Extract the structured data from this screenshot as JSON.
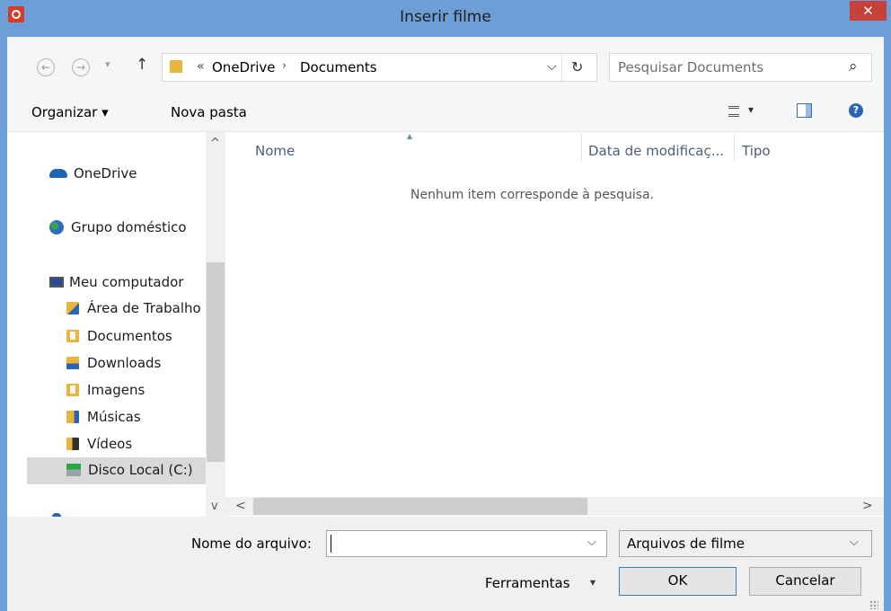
{
  "window": {
    "title": "Inserir filme",
    "close_glyph": "✕"
  },
  "nav": {
    "back": "←",
    "forward": "→",
    "history": "▾",
    "up": "↑"
  },
  "address": {
    "prefix": "«",
    "crumbs": [
      "OneDrive",
      "Documents"
    ],
    "separator": "›",
    "dropdown": "⌵",
    "refresh": "↻"
  },
  "search": {
    "placeholder": "Pesquisar Documents",
    "icon": "⌕"
  },
  "toolbar": {
    "organize_label": "Organizar ▾",
    "new_folder_label": "Nova pasta",
    "view_arrow": "▾",
    "help": "?"
  },
  "sidebar": {
    "scroll_up": "^",
    "scroll_down": "v",
    "items": [
      {
        "label": "OneDrive",
        "icon": "onedrive-icon",
        "color": "#1e64b4"
      },
      {
        "label": "Grupo doméstico",
        "icon": "homegroup-icon"
      },
      {
        "label": "Meu computador",
        "icon": "computer-icon"
      },
      {
        "label": "Área de Trabalho",
        "icon": "desktop-folder-icon"
      },
      {
        "label": "Documentos",
        "icon": "documents-folder-icon"
      },
      {
        "label": "Downloads",
        "icon": "downloads-folder-icon"
      },
      {
        "label": "Imagens",
        "icon": "pictures-folder-icon"
      },
      {
        "label": "Músicas",
        "icon": "music-folder-icon"
      },
      {
        "label": "Vídeos",
        "icon": "videos-folder-icon"
      },
      {
        "label": "Disco Local (C:)",
        "icon": "drive-icon"
      }
    ]
  },
  "filelist": {
    "columns": [
      "Nome",
      "Data de modificaç...",
      "Tipo"
    ],
    "sort_indicator": "▲",
    "empty_message": "Nenhum item corresponde à pesquisa.",
    "scroll_left": "<",
    "scroll_right": ">"
  },
  "footer": {
    "filename_label": "Nome do arquivo:",
    "filename_value": "",
    "filename_dropdown": "⌵",
    "filetype_value": "Arquivos de filme",
    "filetype_dropdown": "⌵",
    "tools_label": "Ferramentas",
    "tools_arrow": "▾",
    "ok_label": "OK",
    "cancel_label": "Cancelar"
  },
  "colors": {
    "accent": "#6d9fd6",
    "close": "#c7403a",
    "selected": "#d9d9d9"
  }
}
